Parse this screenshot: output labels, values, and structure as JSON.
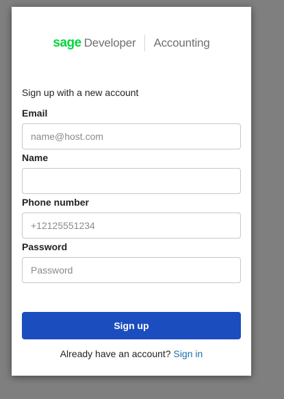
{
  "brand": {
    "logo_text": "sage",
    "developer_text": "Developer",
    "product_text": "Accounting",
    "logo_color": "#00d639"
  },
  "form": {
    "intro": "Sign up with a new account",
    "email": {
      "label": "Email",
      "placeholder": "name@host.com",
      "value": ""
    },
    "name": {
      "label": "Name",
      "placeholder": "",
      "value": ""
    },
    "phone": {
      "label": "Phone number",
      "placeholder": "+12125551234",
      "value": ""
    },
    "password": {
      "label": "Password",
      "placeholder": "Password",
      "value": ""
    },
    "submit_label": "Sign up",
    "submit_color": "#1b4dbe"
  },
  "footer": {
    "prompt": "Already have an account?",
    "signin_link": "Sign in",
    "link_color": "#1a6fa8"
  }
}
